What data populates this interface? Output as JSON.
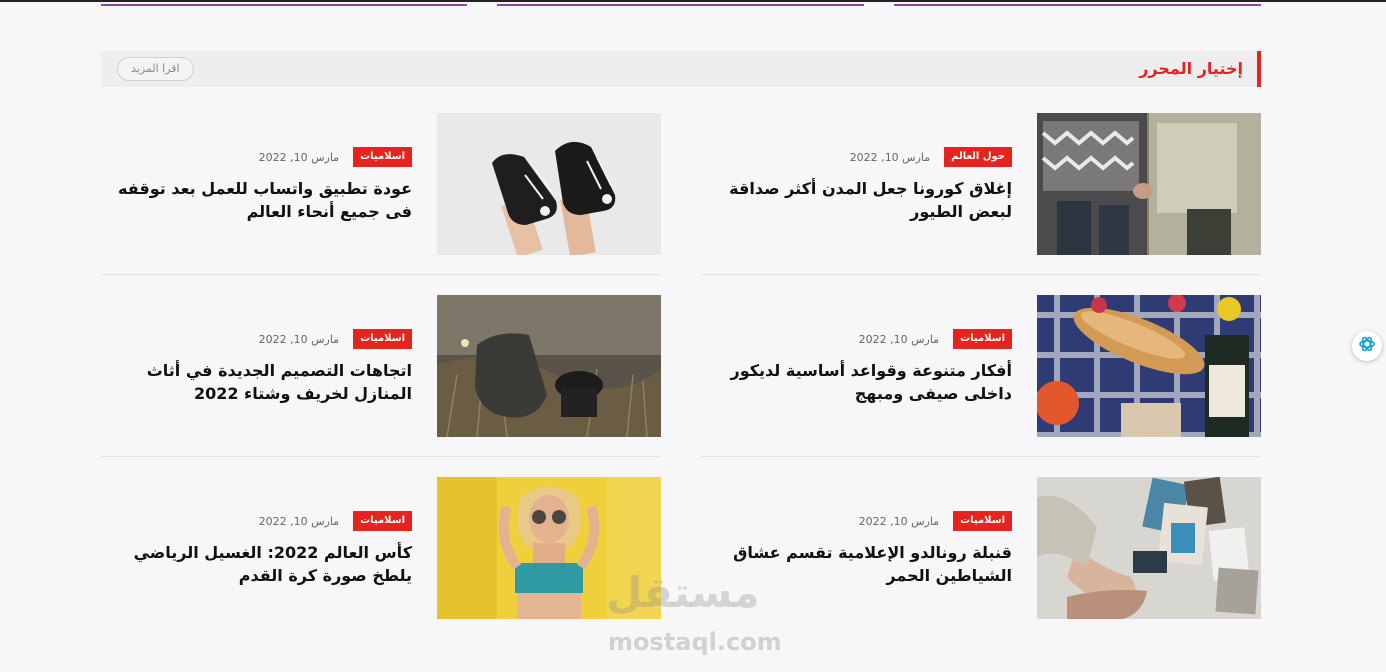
{
  "section": {
    "title": "إختيار المحرر",
    "read_more": "اقرا المزيد"
  },
  "articles": [
    {
      "category": "حول العالم",
      "date": "مارس 10, 2022",
      "title": "إغلاق كورونا جعل المدن أكثر صداقة لبعض الطيور"
    },
    {
      "category": "اسلاميات",
      "date": "مارس 10, 2022",
      "title": "عودة تطبيق واتساب للعمل بعد توقفه فى جميع أنحاء العالم"
    },
    {
      "category": "اسلاميات",
      "date": "مارس 10, 2022",
      "title": "أفكار متنوعة وقواعد أساسية لديكور داخلى صيفى ومبهج"
    },
    {
      "category": "اسلاميات",
      "date": "مارس 10, 2022",
      "title": "اتجاهات التصميم الجديدة في أثاث المنازل لخريف وشتاء 2022"
    },
    {
      "category": "اسلاميات",
      "date": "مارس 10, 2022",
      "title": "قنبلة رونالدو الإعلامية تقسم عشاق الشياطين الحمر"
    },
    {
      "category": "اسلاميات",
      "date": "مارس 10, 2022",
      "title": "كأس العالم 2022: الغسيل الرياضي يلطخ صورة كرة القدم"
    }
  ],
  "watermark": {
    "logo": "مستقل",
    "url": "mostaql.com"
  },
  "colors": {
    "accent": "#e5231f",
    "purple": "#8e44ad",
    "background": "#f7f7f9"
  },
  "icons": {
    "chat": "chat-assistant-icon"
  }
}
